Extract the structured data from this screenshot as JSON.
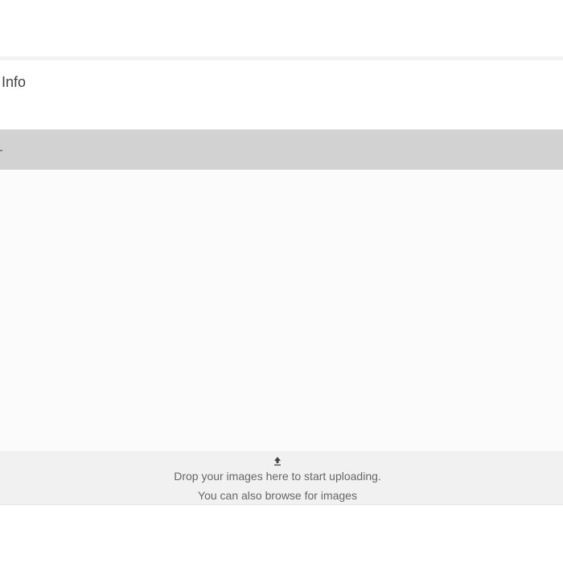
{
  "section": {
    "title": "rt Info"
  },
  "tabs": {
    "active_label": "AL"
  },
  "dropzone": {
    "icon": "upload-icon",
    "line1": "Drop your images here to start uploading.",
    "line2": "You can also browse for images"
  }
}
